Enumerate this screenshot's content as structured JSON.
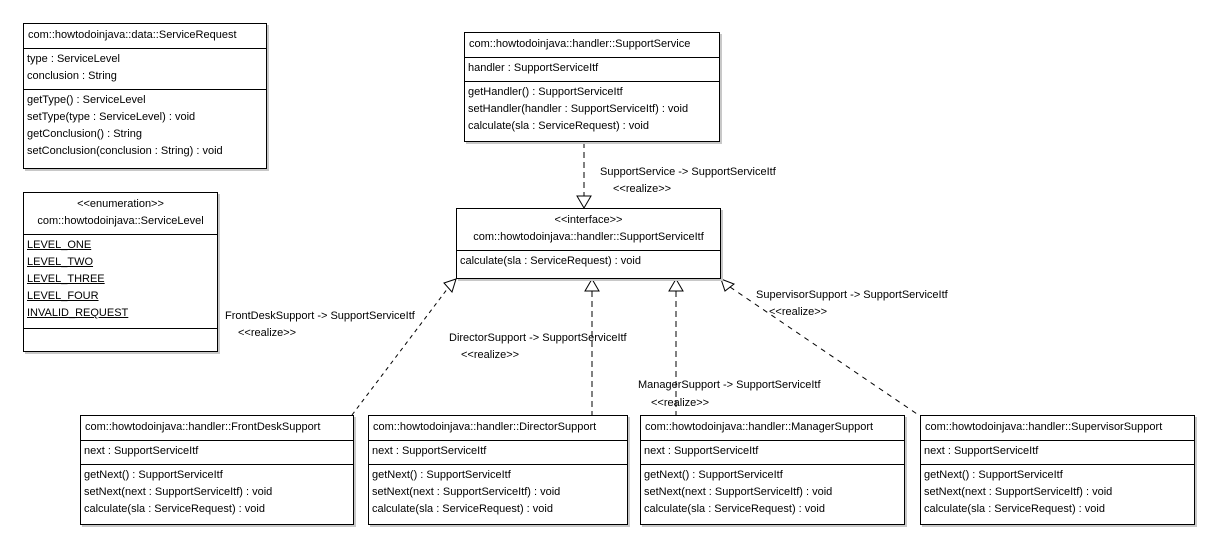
{
  "diagram": {
    "type": "UML class diagram",
    "classes": {
      "service_request": {
        "name": "com::howtodoinjava::data::ServiceRequest",
        "attributes": [
          "type : ServiceLevel",
          "conclusion : String"
        ],
        "operations": [
          "getType() : ServiceLevel",
          "setType(type : ServiceLevel) : void",
          "getConclusion() : String",
          "setConclusion(conclusion : String) : void"
        ]
      },
      "service_level": {
        "stereotype": "<<enumeration>>",
        "name": "com::howtodoinjava::ServiceLevel",
        "literals": [
          "LEVEL_ONE",
          "LEVEL_TWO",
          "LEVEL_THREE",
          "LEVEL_FOUR",
          "INVALID_REQUEST"
        ]
      },
      "support_service": {
        "name": "com::howtodoinjava::handler::SupportService",
        "attributes": [
          "handler : SupportServiceItf"
        ],
        "operations": [
          "getHandler() : SupportServiceItf",
          "setHandler(handler : SupportServiceItf) : void",
          "calculate(sla : ServiceRequest) : void"
        ]
      },
      "support_service_itf": {
        "stereotype": "<<interface>>",
        "name": "com::howtodoinjava::handler::SupportServiceItf",
        "operations": [
          "calculate(sla : ServiceRequest) : void"
        ]
      },
      "front_desk_support": {
        "name": "com::howtodoinjava::handler::FrontDeskSupport",
        "attributes": [
          "next : SupportServiceItf"
        ],
        "operations": [
          "getNext() : SupportServiceItf",
          "setNext(next : SupportServiceItf) : void",
          "calculate(sla : ServiceRequest) : void"
        ]
      },
      "director_support": {
        "name": "com::howtodoinjava::handler::DirectorSupport",
        "attributes": [
          "next : SupportServiceItf"
        ],
        "operations": [
          "getNext() : SupportServiceItf",
          "setNext(next : SupportServiceItf) : void",
          "calculate(sla : ServiceRequest) : void"
        ]
      },
      "manager_support": {
        "name": "com::howtodoinjava::handler::ManagerSupport",
        "attributes": [
          "next : SupportServiceItf"
        ],
        "operations": [
          "getNext() : SupportServiceItf",
          "setNext(next : SupportServiceItf) : void",
          "calculate(sla : ServiceRequest) : void"
        ]
      },
      "supervisor_support": {
        "name": "com::howtodoinjava::handler::SupervisorSupport",
        "attributes": [
          "next : SupportServiceItf"
        ],
        "operations": [
          "getNext() : SupportServiceItf",
          "setNext(next : SupportServiceItf) : void",
          "calculate(sla : ServiceRequest) : void"
        ]
      }
    },
    "relations": {
      "support_service": {
        "label": "SupportService -> SupportServiceItf",
        "stereotype": "<<realize>>"
      },
      "front_desk": {
        "label": "FrontDeskSupport -> SupportServiceItf",
        "stereotype": "<<realize>>"
      },
      "director": {
        "label": "DirectorSupport -> SupportServiceItf",
        "stereotype": "<<realize>>"
      },
      "manager": {
        "label": "ManagerSupport -> SupportServiceItf",
        "stereotype": "<<realize>>"
      },
      "supervisor": {
        "label": "SupervisorSupport -> SupportServiceItf",
        "stereotype": "<<realize>>"
      }
    }
  }
}
